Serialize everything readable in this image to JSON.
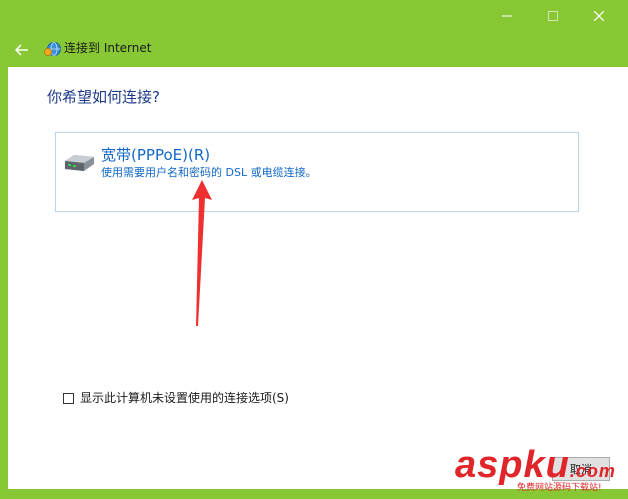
{
  "window": {
    "title": "连接到 Internet",
    "accent_color": "#88c834",
    "controls": {
      "minimize": "minimize-icon",
      "maximize": "maximize-icon",
      "close": "close-icon"
    },
    "back_icon": "back-arrow-icon",
    "title_icon": "network-globe-icon"
  },
  "main": {
    "question": "你希望如何连接?",
    "option": {
      "title": "宽带(PPPoE)(R)",
      "description": "使用需要用户名和密码的 DSL 或电缆连接。",
      "icon": "modem-icon",
      "text_color": "#1168c8"
    },
    "checkbox_label": "显示此计算机未设置使用的连接选项(S)",
    "checkbox_checked": false,
    "footer_button_label": "取消",
    "annotation_arrow_color": "#ee3030"
  },
  "watermark": {
    "main": "aspku",
    "domain": ".com",
    "subtitle": "免费网站源码下载站!"
  }
}
